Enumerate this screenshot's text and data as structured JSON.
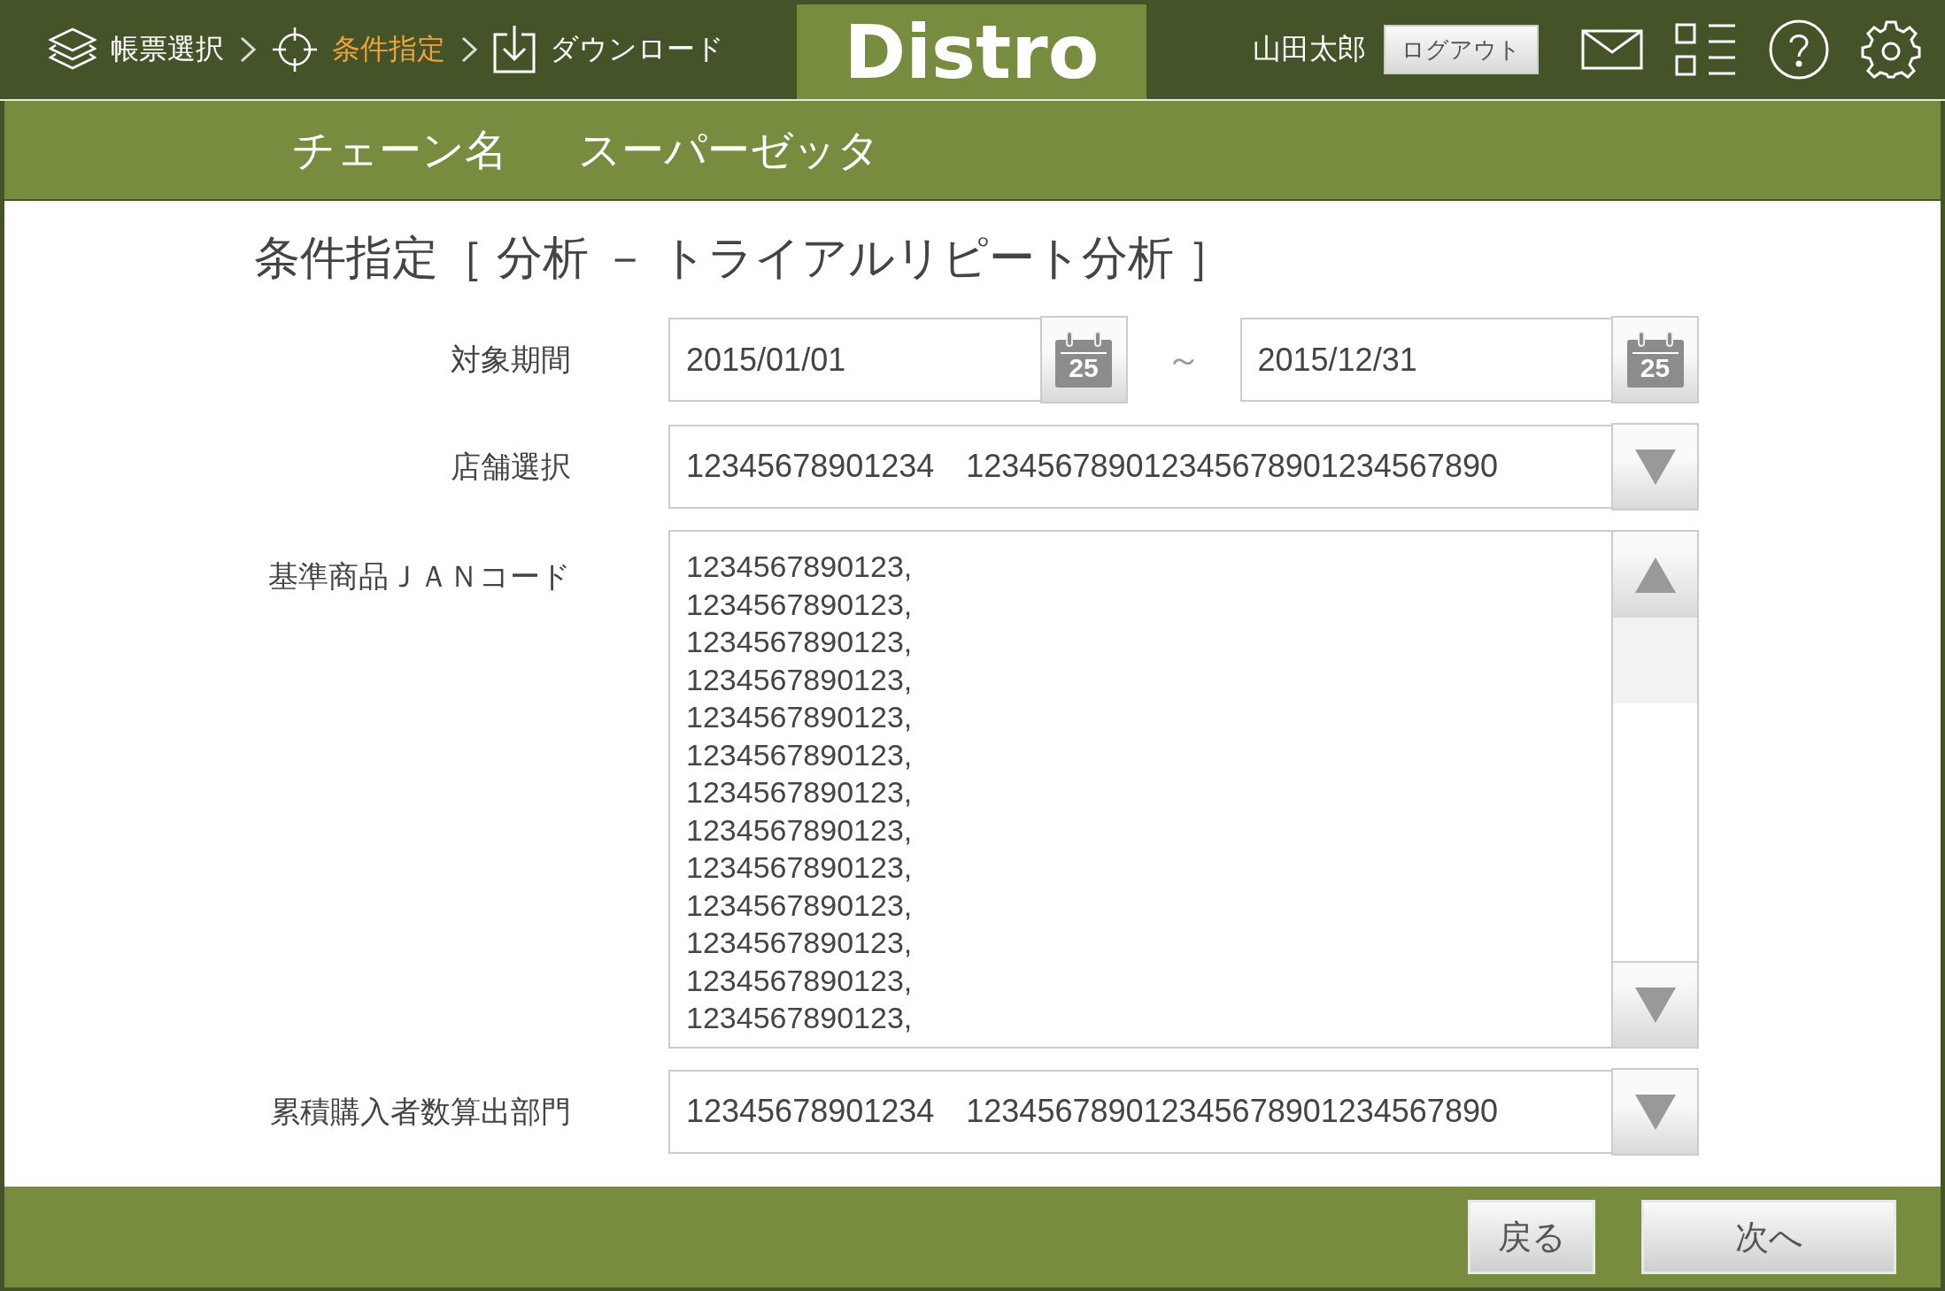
{
  "header": {
    "breadcrumb": [
      {
        "label": "帳票選択",
        "selected": false
      },
      {
        "label": "条件指定",
        "selected": true
      },
      {
        "label": "ダウンロード",
        "selected": false
      }
    ],
    "logo": "Distro",
    "user_name": "山田太郎",
    "logout": "ログアウト"
  },
  "chain": {
    "label": "チェーン名",
    "value": "スーパーゼッタ"
  },
  "title": "条件指定［ 分析 － トライアルリピート分析 ］",
  "fields": [
    {
      "kind": "date_range",
      "label": "対象期間",
      "from": "2015/01/01",
      "to": "2015/12/31",
      "separator": "～",
      "calendar_days": [
        "25",
        "25"
      ]
    },
    {
      "kind": "select",
      "label": "店舗選択",
      "value": "12345678901234　123456789012345678901234567890"
    },
    {
      "kind": "textarea",
      "label": "基準商品ＪＡＮコード",
      "lines": [
        "1234567890123,",
        "1234567890123,",
        "1234567890123,",
        "1234567890123,",
        "1234567890123,",
        "1234567890123,",
        "1234567890123,",
        "1234567890123,",
        "1234567890123,",
        "1234567890123,",
        "1234567890123,",
        "1234567890123,",
        "1234567890123,"
      ]
    },
    {
      "kind": "select",
      "label": "累積購入者数算出部門",
      "value": "12345678901234　123456789012345678901234567890"
    }
  ],
  "footer": {
    "buttons": [
      "戻る",
      "次へ"
    ]
  }
}
